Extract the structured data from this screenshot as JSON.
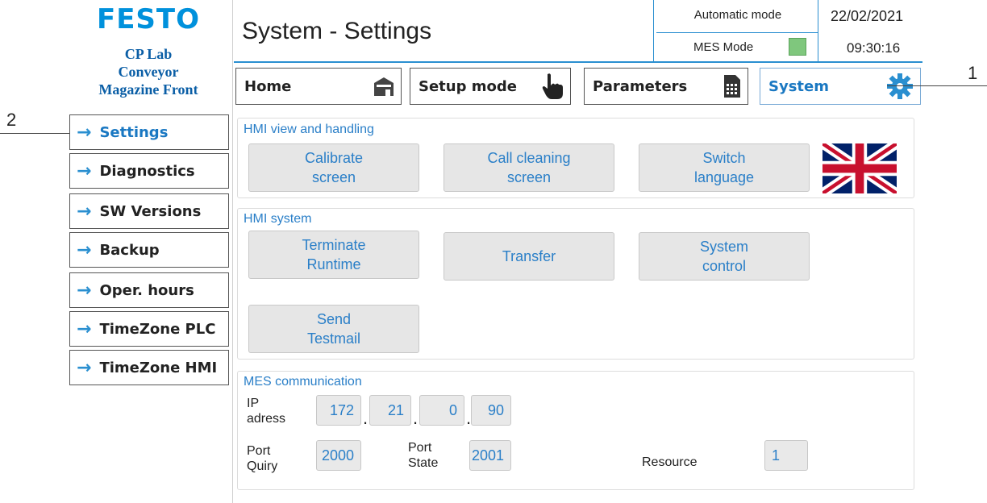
{
  "brand": {
    "logo": "FESTO"
  },
  "station": {
    "line1": "CP Lab",
    "line2": "Conveyor",
    "line3": "Magazine Front"
  },
  "header": {
    "title": "System - Settings",
    "automatic_mode": "Automatic mode",
    "mes_mode": "MES Mode",
    "mes_led_color": "#7fc77d",
    "date": "22/02/2021",
    "time": "09:30:16"
  },
  "nav": {
    "home": "Home",
    "setup": "Setup mode",
    "parameters": "Parameters",
    "system": "System"
  },
  "sidebar": {
    "items": [
      {
        "label": "Settings"
      },
      {
        "label": "Diagnostics"
      },
      {
        "label": "SW Versions"
      },
      {
        "label": "Backup"
      },
      {
        "label": "Oper. hours"
      },
      {
        "label": "TimeZone PLC"
      },
      {
        "label": "TimeZone HMI"
      }
    ]
  },
  "callouts": {
    "one": "1",
    "two": "2"
  },
  "hmi_view": {
    "title": "HMI view and handling",
    "calibrate": "Calibrate\nscreen",
    "cleaning": "Call cleaning\nscreen",
    "language": "Switch\nlanguage",
    "flag_icon": "uk-flag-icon"
  },
  "hmi_system": {
    "title": "HMI system",
    "terminate": "Terminate\nRuntime",
    "transfer": "Transfer",
    "system_control": "System\ncontrol",
    "testmail": "Send\nTestmail"
  },
  "mes": {
    "title": "MES communication",
    "ip_label": "IP\nadress",
    "ip": [
      "172",
      "21",
      "0",
      "90"
    ],
    "port_quiry_label": "Port\nQuiry",
    "port_quiry": "2000",
    "port_state_label": "Port\nState",
    "port_state": "2001",
    "resource_label": "Resource",
    "resource": "1"
  },
  "colors": {
    "accent": "#2a8fd0",
    "brand": "#0091dc"
  }
}
